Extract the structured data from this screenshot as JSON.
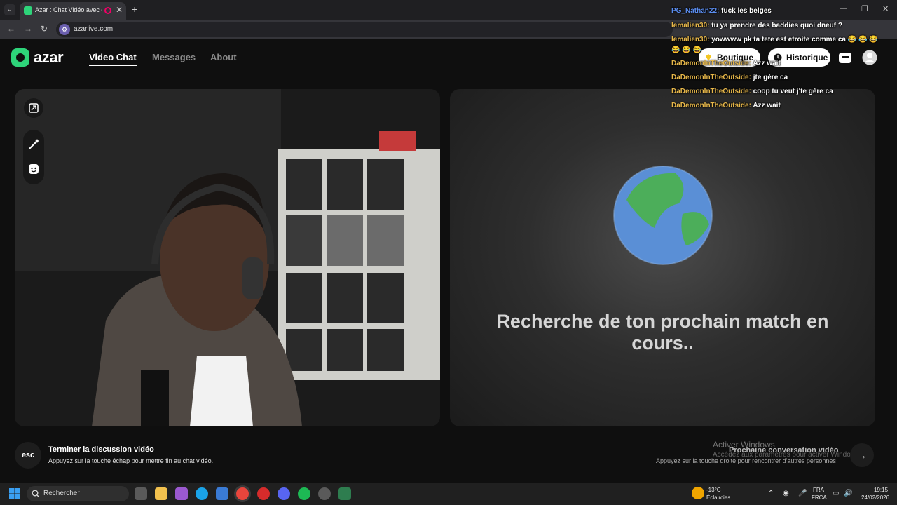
{
  "browser": {
    "tab_title": "Azar : Chat Vidéo avec de n",
    "tab_close": "✕",
    "new_tab": "+",
    "url": "azarlive.com",
    "window_controls": [
      "—",
      "❐",
      "✕"
    ]
  },
  "header": {
    "logo": "azar",
    "nav": [
      "Video Chat",
      "Messages",
      "About"
    ],
    "boutique_label": "Boutique",
    "historique_label": "Historique"
  },
  "main": {
    "search_status": "Recherche de ton prochain match en cours.."
  },
  "bottom": {
    "esc_key": "esc",
    "end_title": "Terminer la discussion vidéo",
    "end_subtitle": "Appuyez sur la touche échap pour mettre fin au chat vidéo.",
    "next_title": "Prochaine conversation vidéo",
    "next_subtitle": "Appuyez sur la touche droite pour rencontrer d'autres personnes",
    "next_arrow": "→"
  },
  "windows_activation": {
    "title": "Activer Windows",
    "subtitle": "Accédez aux paramètres pour activer Windows."
  },
  "chat": [
    {
      "user": "PG_Nathan22:",
      "message": "fuck les belges",
      "user_color": "blue"
    },
    {
      "user": "lemalien30:",
      "message": "tu ya prendre des baddies quoi dneuf ?",
      "user_color": "gold"
    },
    {
      "user": "lemalien30:",
      "message": "yowwww pk ta tete est etroite comme ca 😂 😂 😂",
      "user_color": "gold"
    },
    {
      "user": "",
      "message": "😂 😂 😂",
      "user_color": "gold"
    },
    {
      "user": "DaDemonInTheOutside:",
      "message": "Azz wait",
      "user_color": "gold"
    },
    {
      "user": "DaDemonInTheOutside:",
      "message": "jte gère ca",
      "user_color": "gold"
    },
    {
      "user": "DaDemonInTheOutside:",
      "message": "coop tu veut j'te gère ca",
      "user_color": "gold"
    },
    {
      "user": "DaDemonInTheOutside:",
      "message": "Azz wait",
      "user_color": "gold"
    }
  ],
  "taskbar": {
    "search_placeholder": "Rechercher",
    "weather_temp": "-13°C",
    "weather_desc": "Éclaircies",
    "lang_top": "FRA",
    "lang_bottom": "FRCA",
    "time": "19:15",
    "date": "24/02/2026"
  },
  "colors": {
    "accent": "#2ed47a",
    "chat_user": "#e8b84a",
    "chat_user_alt": "#5b8def"
  }
}
